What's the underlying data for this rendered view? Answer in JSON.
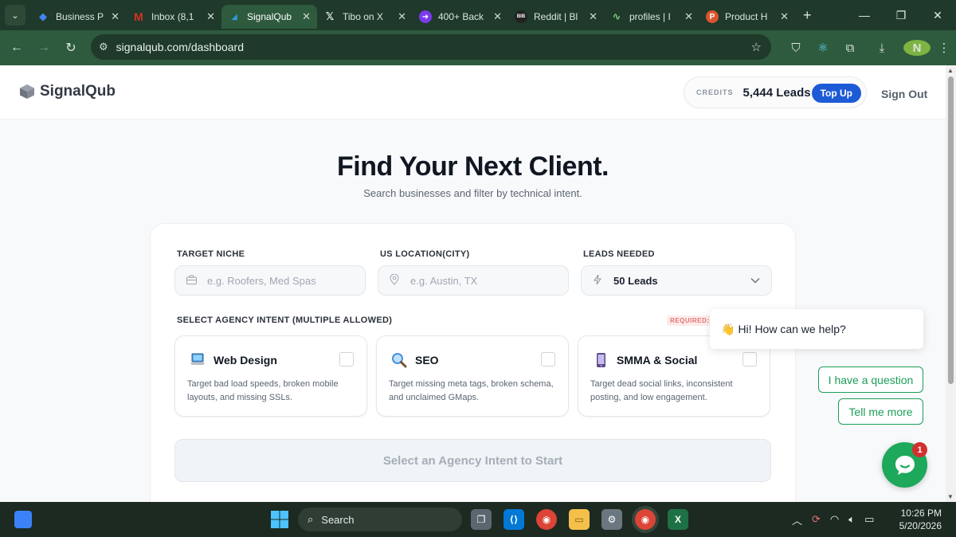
{
  "browser": {
    "tabs": [
      {
        "title": "Business P",
        "color": "#4285f4",
        "glyph": "◆"
      },
      {
        "title": "Inbox (8,1",
        "color": "#d93025",
        "glyph": "M"
      },
      {
        "title": "SignalQub",
        "color": "#2e9bd6",
        "glyph": "◢",
        "active": true
      },
      {
        "title": "Tibo on X",
        "color": "#000000",
        "glyph": "X"
      },
      {
        "title": "400+ Back",
        "color": "#7c3aed",
        "glyph": "➜"
      },
      {
        "title": "Reddit | Bl",
        "color": "#222222",
        "glyph": "BIB"
      },
      {
        "title": "profiles | I",
        "color": "#2e7d32",
        "glyph": "∿"
      },
      {
        "title": "Product H",
        "color": "#da552f",
        "glyph": "P"
      }
    ],
    "url": "signalqub.com/dashboard",
    "profile_initial": "N"
  },
  "header": {
    "brand": "SignalQub",
    "credits_label": "CREDITS",
    "credits_value": "5,444 Leads",
    "topup_label": "Top Up",
    "signout_label": "Sign Out"
  },
  "hero": {
    "title": "Find Your Next Client.",
    "subtitle": "Search businesses and filter by technical intent."
  },
  "form": {
    "niche_label": "TARGET NICHE",
    "niche_placeholder": "e.g. Roofers, Med Spas",
    "location_label": "US LOCATION(CITY)",
    "location_placeholder": "e.g. Austin, TX",
    "leads_label": "LEADS NEEDED",
    "leads_value": "50 Leads",
    "intent_label": "SELECT AGENCY INTENT (MULTIPLE ALLOWED)",
    "required_tag": "REQUIRED: S",
    "intents": [
      {
        "title": "Web Design",
        "desc": "Target bad load speeds, broken mobile layouts, and missing SSLs.",
        "icon": "laptop-icon",
        "checked": false
      },
      {
        "title": "SEO",
        "desc": "Target missing meta tags, broken schema, and unclaimed GMaps.",
        "icon": "magnifier-icon",
        "checked": false
      },
      {
        "title": "SMMA & Social",
        "desc": "Target dead social links, inconsistent posting, and low engagement.",
        "icon": "phone-icon",
        "checked": false
      }
    ],
    "start_label": "Select an Agency Intent to Start"
  },
  "chat": {
    "greeting": "Hi! How can we help?",
    "option1": "I have a question",
    "option2": "Tell me more",
    "badge": "1"
  },
  "taskbar": {
    "search_label": "Search",
    "time": "10:26 PM",
    "date": "5/20/2026"
  },
  "colors": {
    "accent": "#1d5ad6",
    "chat_green": "#1ea85c",
    "browser_frame": "#2e5a3e"
  }
}
